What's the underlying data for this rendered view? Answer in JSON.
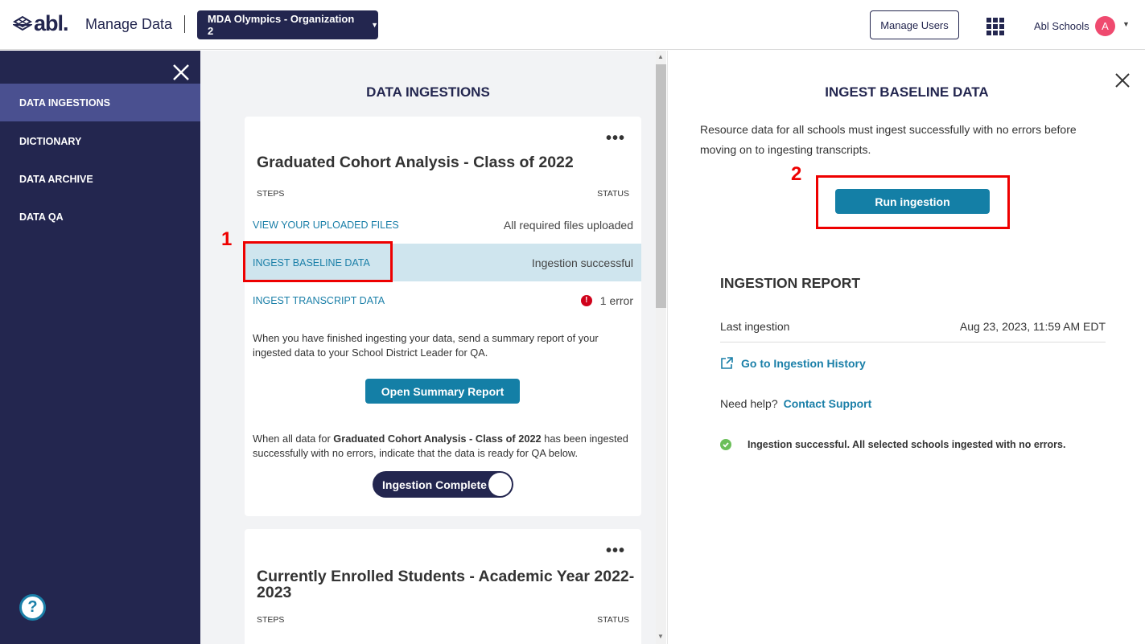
{
  "header": {
    "logo_text": "abl.",
    "app_title": "Manage Data",
    "org_selector": "MDA Olympics - Organization 2",
    "manage_users": "Manage Users",
    "user_name": "Abl Schools",
    "avatar_initial": "A"
  },
  "sidebar": {
    "items": [
      {
        "label": "DATA INGESTIONS",
        "active": true
      },
      {
        "label": "DICTIONARY"
      },
      {
        "label": "DATA ARCHIVE"
      },
      {
        "label": "DATA QA"
      }
    ],
    "help": "?"
  },
  "middle": {
    "title": "DATA INGESTIONS",
    "cards": [
      {
        "title": "Graduated Cohort Analysis - Class of 2022",
        "steps_label": "STEPS",
        "status_label": "STATUS",
        "steps": [
          {
            "label": "VIEW YOUR UPLOADED FILES",
            "status": "All required files uploaded"
          },
          {
            "label": "INGEST BASELINE DATA",
            "status": "Ingestion successful",
            "selected": true
          },
          {
            "label": "INGEST TRANSCRIPT DATA",
            "status": "1 error",
            "error": true
          }
        ],
        "summary_text": "When you have finished ingesting your data, send a summary report of your ingested data to your School District Leader for QA.",
        "summary_button": "Open Summary Report",
        "complete_text_pre": "When all data for ",
        "complete_text_bold": "Graduated Cohort Analysis - Class of 2022",
        "complete_text_post": " has been ingested successfully with no errors, indicate that the data is ready for QA below.",
        "toggle_label": "Ingestion Complete"
      },
      {
        "title": "Currently Enrolled Students - Academic Year 2022-2023",
        "steps_label": "STEPS",
        "status_label": "STATUS"
      }
    ]
  },
  "right": {
    "title": "INGEST BASELINE DATA",
    "description": "Resource data for all schools must ingest successfully with no errors before moving on to ingesting transcripts.",
    "run_button": "Run ingestion",
    "report_title": "INGESTION REPORT",
    "last_ingestion_label": "Last ingestion",
    "last_ingestion_value": "Aug 23, 2023, 11:59 AM EDT",
    "history_link": "Go to Ingestion History",
    "help_text": "Need help?",
    "support_link": "Contact Support",
    "success_message": "Ingestion successful. All selected schools ingested with no errors."
  },
  "annotations": {
    "one": "1",
    "two": "2"
  },
  "colors": {
    "navy": "#23264f",
    "teal": "#147fa6",
    "sidebar_active": "#4a5090",
    "selected_row": "#cfe5ee",
    "annotation_red": "#e00000"
  }
}
